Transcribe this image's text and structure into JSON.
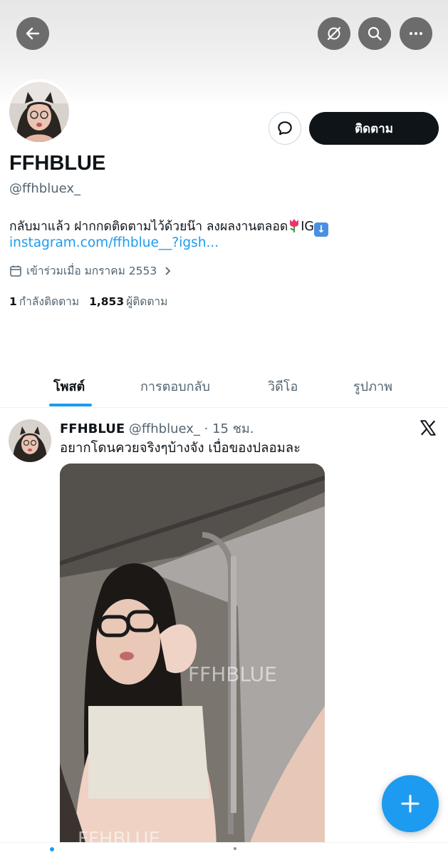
{
  "header": {
    "back_icon": "arrow-left-icon",
    "grok_icon": "grok-icon",
    "search_icon": "search-icon",
    "more_icon": "more-horizontal-icon"
  },
  "profile": {
    "display_name": "FFHBLUE",
    "handle": "@ffhbluex_",
    "bio_text": "กลับมาแล้ว ฝากกดติดตามไว้ด้วยน๊า ลงผลงานตลอด",
    "bio_suffix": "IG",
    "link": "instagram.com/ffhblue__?igsh...",
    "joined": "เข้าร่วมเมื่อ มกราคม 2553",
    "following_count": "1",
    "following_label": "กำลังติดตาม",
    "followers_count": "1,853",
    "followers_label": "ผู้ติดตาม",
    "follow_button": "ติดตาม"
  },
  "tabs": [
    {
      "label": "โพสต์",
      "active": true
    },
    {
      "label": "การตอบกลับ",
      "active": false
    },
    {
      "label": "วิดีโอ",
      "active": false
    },
    {
      "label": "รูปภาพ",
      "active": false
    }
  ],
  "tweet": {
    "name": "FFHBLUE",
    "meta": "@ffhbluex_ · 15 ชม.",
    "text": "อยากโดนควยจริงๆบ้างจัง เบื่อของปลอมละ",
    "watermark": "FFHBLUE"
  },
  "colors": {
    "accent": "#1d9bf0",
    "text_primary": "#0f1419",
    "text_secondary": "#536471",
    "header_button": "#6c6c6c"
  }
}
